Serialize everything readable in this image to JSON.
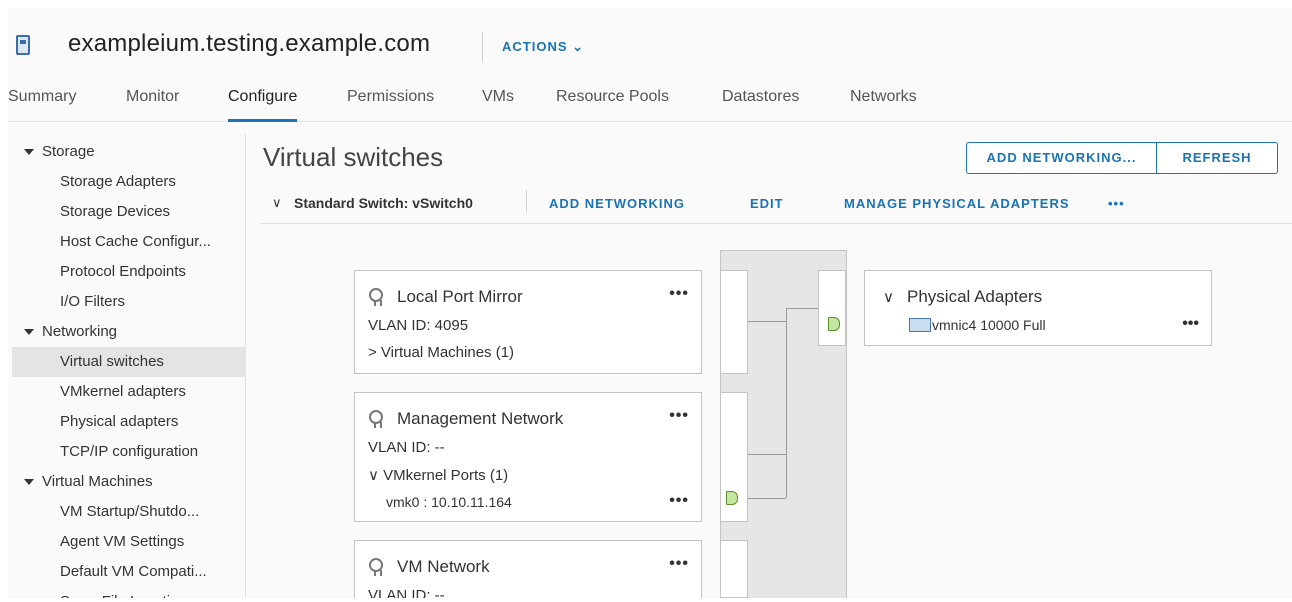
{
  "header": {
    "host": "exampleium.testing.example.com",
    "actions_label": "ACTIONS ⌄"
  },
  "tabs": [
    {
      "label": "Summary"
    },
    {
      "label": "Monitor"
    },
    {
      "label": "Configure",
      "active": true
    },
    {
      "label": "Permissions"
    },
    {
      "label": "VMs"
    },
    {
      "label": "Resource Pools"
    },
    {
      "label": "Datastores"
    },
    {
      "label": "Networks"
    }
  ],
  "sidebar": {
    "groups": [
      {
        "label": "Storage",
        "items": [
          "Storage Adapters",
          "Storage Devices",
          "Host Cache Configur...",
          "Protocol Endpoints",
          "I/O Filters"
        ]
      },
      {
        "label": "Networking",
        "items": [
          "Virtual switches",
          "VMkernel adapters",
          "Physical adapters",
          "TCP/IP configuration"
        ]
      },
      {
        "label": "Virtual Machines",
        "items": [
          "VM Startup/Shutdo...",
          "Agent VM Settings",
          "Default VM Compati...",
          "Swap File Location"
        ]
      }
    ],
    "selected": "Virtual switches"
  },
  "main": {
    "title": "Virtual switches",
    "add_networking_btn": "ADD NETWORKING...",
    "refresh_btn": "REFRESH",
    "switch": {
      "chevron": "∨",
      "name": "Standard Switch: vSwitch0",
      "add_networking_link": "ADD NETWORKING",
      "edit_link": "EDIT",
      "manage_link": "MANAGE PHYSICAL ADAPTERS",
      "more": "•••"
    },
    "port_groups": [
      {
        "name": "Local Port Mirror",
        "vlan": "VLAN ID: 4095",
        "expander": "> Virtual Machines (1)",
        "more": "•••"
      },
      {
        "name": "Management Network",
        "vlan": "VLAN ID: --",
        "expander": "∨ VMkernel Ports (1)",
        "vmk": "vmk0 : 10.10.11.164",
        "more": "•••",
        "vmk_more": "•••"
      },
      {
        "name": "VM Network",
        "vlan": "VLAN ID: --",
        "more": "•••"
      }
    ],
    "physical_adapters": {
      "chevron": "∨",
      "title": "Physical Adapters",
      "nic": "vmnic4 10000 Full",
      "more": "•••"
    }
  },
  "colors": {
    "accent": "#1a73b5",
    "port": "#c4e8a1",
    "selected_bg": "#e4e4e4"
  }
}
